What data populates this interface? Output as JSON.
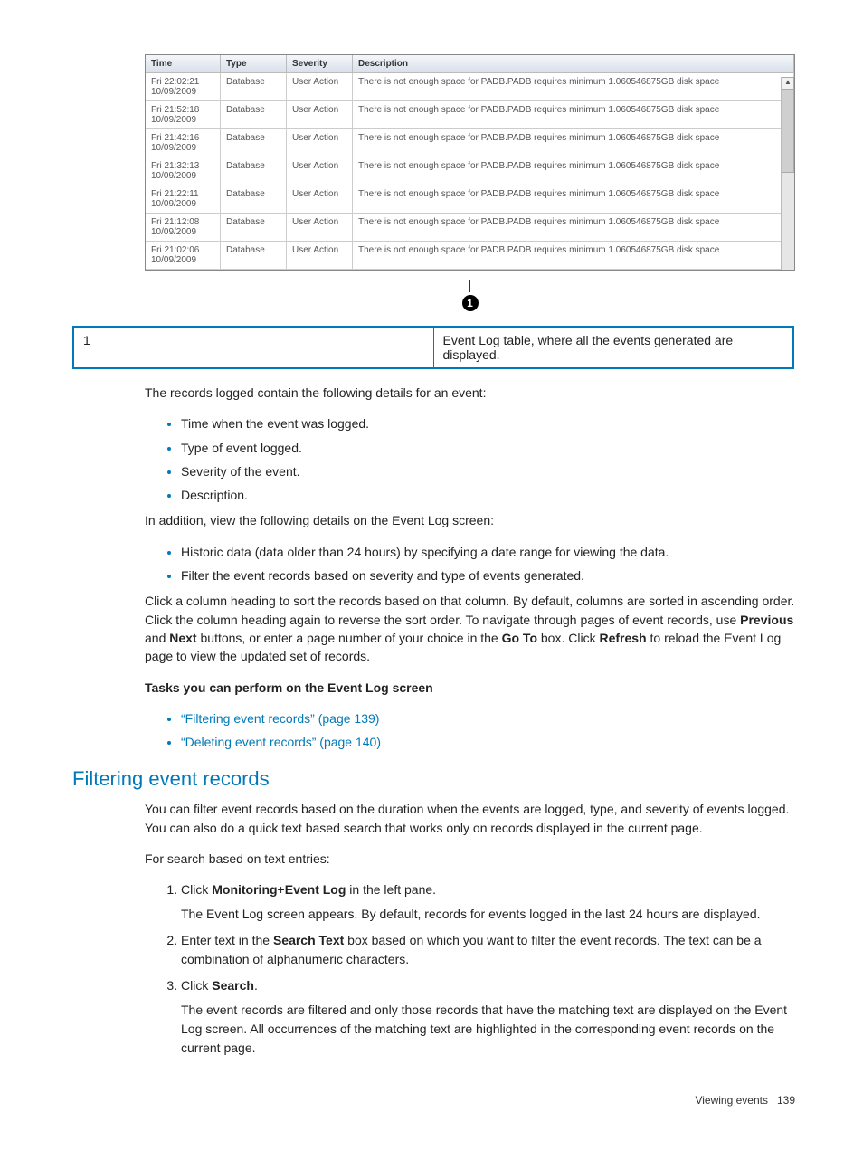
{
  "event_table": {
    "headers": [
      "Time",
      "Type",
      "Severity",
      "Description"
    ],
    "rows": [
      {
        "time_a": "Fri 22:02:21",
        "time_b": "10/09/2009",
        "type": "Database",
        "sev": "User Action",
        "desc": "There is not enough space for PADB.PADB requires minimum 1.060546875GB disk space"
      },
      {
        "time_a": "Fri 21:52:18",
        "time_b": "10/09/2009",
        "type": "Database",
        "sev": "User Action",
        "desc": "There is not enough space for PADB.PADB requires minimum 1.060546875GB disk space"
      },
      {
        "time_a": "Fri 21:42:16",
        "time_b": "10/09/2009",
        "type": "Database",
        "sev": "User Action",
        "desc": "There is not enough space for PADB.PADB requires minimum 1.060546875GB disk space"
      },
      {
        "time_a": "Fri 21:32:13",
        "time_b": "10/09/2009",
        "type": "Database",
        "sev": "User Action",
        "desc": "There is not enough space for PADB.PADB requires minimum 1.060546875GB disk space"
      },
      {
        "time_a": "Fri 21:22:11",
        "time_b": "10/09/2009",
        "type": "Database",
        "sev": "User Action",
        "desc": "There is not enough space for PADB.PADB requires minimum 1.060546875GB disk space"
      },
      {
        "time_a": "Fri 21:12:08",
        "time_b": "10/09/2009",
        "type": "Database",
        "sev": "User Action",
        "desc": "There is not enough space for PADB.PADB requires minimum 1.060546875GB disk space"
      },
      {
        "time_a": "Fri 21:02:06",
        "time_b": "10/09/2009",
        "type": "Database",
        "sev": "User Action",
        "desc": "There is not enough space for PADB.PADB requires minimum 1.060546875GB disk space"
      }
    ]
  },
  "callout_number": "1",
  "legend": {
    "key": "1",
    "value": "Event Log table, where all the events generated are displayed."
  },
  "para_records_intro": "The records logged contain the following details for an event:",
  "details_list": [
    "Time when the event was logged.",
    "Type of event logged.",
    "Severity of the event.",
    "Description."
  ],
  "para_in_addition": "In addition, view the following details on the Event Log screen:",
  "addition_list": [
    "Historic data (data older than 24 hours) by specifying a date range for viewing the data.",
    "Filter the event records based on severity and type of events generated."
  ],
  "para_click_col_1": "Click a column heading to sort the records based on that column. By default, columns are sorted in ascending order. Click the column heading again to reverse the sort order. To navigate through pages of event records, use ",
  "w_previous": "Previous",
  "w_and": " and ",
  "w_next": "Next",
  "para_click_col_2": " buttons, or enter a page number of your choice in the ",
  "w_goto": "Go To",
  "para_click_col_3": " box. Click ",
  "w_refresh": "Refresh",
  "para_click_col_4": " to reload the Event Log page to view the updated set of records.",
  "tasks_heading": "Tasks you can perform on the Event Log screen",
  "task_links": [
    "“Filtering event records” (page 139)",
    "“Deleting event records” (page 140)"
  ],
  "h2_filtering": "Filtering event records",
  "para_filter_intro": "You can filter event records based on the duration when the events are logged, type, and severity of events logged. You can also do a quick text based search that works only on records displayed in the current page.",
  "para_search_intro": "For search based on text entries:",
  "steps": {
    "s1a": "Click ",
    "s1_mon": "Monitoring",
    "s1_plus": "+",
    "s1_evt": "Event Log",
    "s1b": " in the left pane.",
    "s1_p": "The Event Log screen appears. By default, records for events logged in the last 24 hours are displayed.",
    "s2a": "Enter text in the ",
    "s2_st": "Search Text",
    "s2b": " box based on which you want to filter the event records. The text can be a combination of alphanumeric characters.",
    "s3a": "Click ",
    "s3_search": "Search",
    "s3b": ".",
    "s3_p": "The event records are filtered and only those records that have the matching text are displayed on the Event Log screen. All occurrences of the matching text are highlighted in the corresponding event records on the current page."
  },
  "footer": {
    "section": "Viewing events",
    "page": "139"
  }
}
